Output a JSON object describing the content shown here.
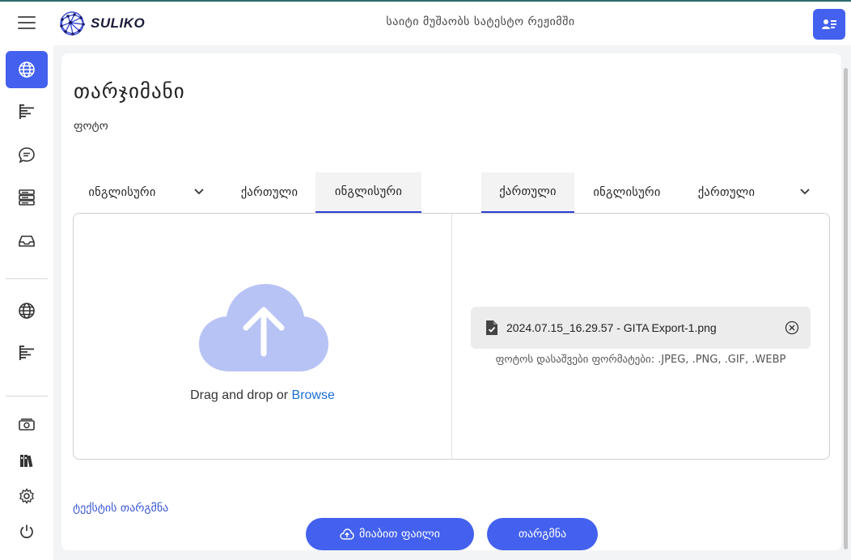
{
  "header": {
    "logo_text": "SULIKO",
    "status_text": "საიტი მუშაობს სატესტო რეჟიმში",
    "icons": [
      "hamburger-menu-icon",
      "logo-brain-icon",
      "profile-card-icon"
    ],
    "accent_color": "#4361ee"
  },
  "sidebar": {
    "items": [
      {
        "name": "globe-icon",
        "active": true
      },
      {
        "name": "text-lines-icon",
        "active": false
      },
      {
        "name": "chat-bubble-icon",
        "active": false
      },
      {
        "name": "server-icon",
        "active": false
      },
      {
        "name": "inbox-icon",
        "active": false
      },
      {
        "name": "globe-icon",
        "active": false
      },
      {
        "name": "text-lines-icon",
        "active": false
      },
      {
        "name": "money-icon",
        "active": false
      },
      {
        "name": "books-icon",
        "active": false
      },
      {
        "name": "gear-icon",
        "active": false
      },
      {
        "name": "power-icon",
        "active": false
      }
    ]
  },
  "page": {
    "title": "თარჯიმანი",
    "subtitle": "ფოტო"
  },
  "source_tabs": {
    "dropdown_label": "ინგლისური",
    "tabs": [
      {
        "label": "ქართული",
        "selected": false
      },
      {
        "label": "ინგლისური",
        "selected": true
      }
    ]
  },
  "target_tabs": {
    "tabs": [
      {
        "label": "ქართული",
        "selected": true
      },
      {
        "label": "ინგლისური",
        "selected": false
      }
    ],
    "dropdown_label": "ქართული"
  },
  "upload": {
    "drag_text": "Drag and drop or ",
    "browse_label": "Browse",
    "cloud_icon": "cloud-upload-icon"
  },
  "file": {
    "name": "2024.07.15_16.29.57 - GITA Export-1.png",
    "formats_text": "ფოტოს დასაშვები ფორმატები: .JPEG, .PNG, .GIF, .WEBP"
  },
  "footer": {
    "text_translate_link": "ტექსტის თარგმნა",
    "attach_button": "მიაბით ფაილი",
    "translate_button": "თარგმნა"
  }
}
